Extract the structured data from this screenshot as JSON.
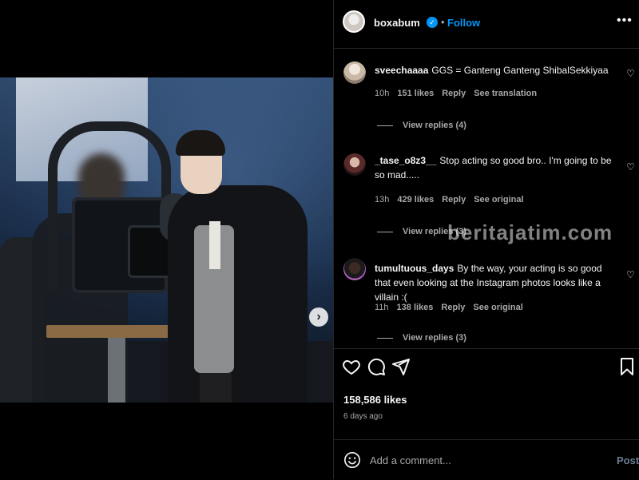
{
  "header": {
    "username": "boxabum",
    "verified_icon": "✓",
    "separator": "•",
    "follow_label": "Follow",
    "more_icon": "•••"
  },
  "comments": [
    {
      "username": "sveechaaaa",
      "text": "GGS = Ganteng Ganteng ShibalSekkiyaa",
      "time": "10h",
      "likes": "151 likes",
      "reply": "Reply",
      "translate": "See translation",
      "view_replies": "View replies (4)"
    },
    {
      "username": "_tase_o8z3__",
      "text": "Stop acting so good bro.. I'm going to be so mad.....",
      "time": "13h",
      "likes": "429 likes",
      "reply": "Reply",
      "translate": "See original",
      "view_replies": "View replies (3)"
    },
    {
      "username": "tumultuous_days",
      "text": "By the way, your acting is so good that even looking at the Instagram photos looks like a villain :(",
      "time": "11h",
      "likes": "138 likes",
      "reply": "Reply",
      "translate": "See original",
      "view_replies": "View replies (3)"
    }
  ],
  "actions": {
    "like_icon": "heart-icon",
    "comment_icon": "comment-icon",
    "share_icon": "share-icon",
    "save_icon": "bookmark-icon"
  },
  "likes_count": "158,586 likes",
  "posted": "6 days ago",
  "add_comment": {
    "placeholder": "Add a comment...",
    "post_label": "Post"
  },
  "media": {
    "next_icon": "›",
    "slide_count": 2,
    "active_slide": 1
  },
  "watermark": "beritajatim.com"
}
